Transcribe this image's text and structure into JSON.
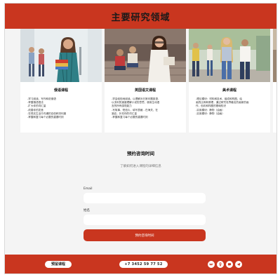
{
  "header": {
    "title": "主要研究领域"
  },
  "cards": [
    {
      "title": "俄语课程",
      "items": [
        "-学习阅读、写作和说俄语",
        "-掌握俄语语法",
        "-扩大你的词汇量",
        "-改善你的发音",
        "-在现实生活中沟通的自信和流利度",
        "-掌握和复习每个必要的重要时刻"
      ]
    },
    {
      "title": "英国语文课程",
      "items": [
        "-学会轻松地阅读。以理解对日常问题英语-",
        "以流利的速度理解小说的意思，使用生动语",
        "言的所有感觉能力",
        "-写故事、短信片，填写表格 - 在海关，在",
        "酒店，补充你的词汇量",
        "-掌握和复习每个必要的重要时刻"
      ]
    },
    {
      "title": "美术课程",
      "items": [
        "-理论模块：材料和技术、组成和构图，绘",
        "画的比例和原理，通过研究世界著名的画家的画",
        "作，色彩和构图的基础知识",
        "-实用模块：静物（油画）",
        "-实用模块：静物（油画）"
      ]
    }
  ],
  "booking": {
    "title": "预约咨询时间",
    "subtitle": "了解如何进入课程的详细信息",
    "email_label": "Email",
    "name_label": "姓名",
    "email_value": "",
    "name_value": "",
    "submit_label": "预约咨询时间"
  },
  "footer": {
    "book_label": "预留课程",
    "phone": "+7 3452 59 77 52",
    "socials": [
      "vk-icon",
      "odnoklassniki-icon",
      "chat-icon",
      "telegram-icon"
    ]
  },
  "colors": {
    "accent": "#c9361f",
    "background": "#f4f4f4",
    "card": "#ffffff"
  }
}
